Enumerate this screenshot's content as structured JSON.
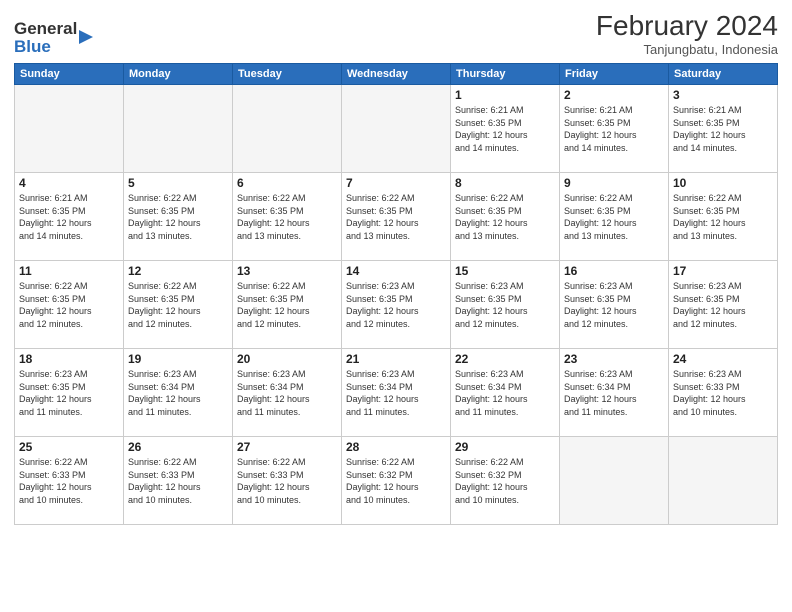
{
  "header": {
    "logo_general": "General",
    "logo_blue": "Blue",
    "month_year": "February 2024",
    "location": "Tanjungbatu, Indonesia"
  },
  "days_of_week": [
    "Sunday",
    "Monday",
    "Tuesday",
    "Wednesday",
    "Thursday",
    "Friday",
    "Saturday"
  ],
  "weeks": [
    [
      {
        "day": "",
        "info": ""
      },
      {
        "day": "",
        "info": ""
      },
      {
        "day": "",
        "info": ""
      },
      {
        "day": "",
        "info": ""
      },
      {
        "day": "1",
        "info": "Sunrise: 6:21 AM\nSunset: 6:35 PM\nDaylight: 12 hours\nand 14 minutes."
      },
      {
        "day": "2",
        "info": "Sunrise: 6:21 AM\nSunset: 6:35 PM\nDaylight: 12 hours\nand 14 minutes."
      },
      {
        "day": "3",
        "info": "Sunrise: 6:21 AM\nSunset: 6:35 PM\nDaylight: 12 hours\nand 14 minutes."
      }
    ],
    [
      {
        "day": "4",
        "info": "Sunrise: 6:21 AM\nSunset: 6:35 PM\nDaylight: 12 hours\nand 14 minutes."
      },
      {
        "day": "5",
        "info": "Sunrise: 6:22 AM\nSunset: 6:35 PM\nDaylight: 12 hours\nand 13 minutes."
      },
      {
        "day": "6",
        "info": "Sunrise: 6:22 AM\nSunset: 6:35 PM\nDaylight: 12 hours\nand 13 minutes."
      },
      {
        "day": "7",
        "info": "Sunrise: 6:22 AM\nSunset: 6:35 PM\nDaylight: 12 hours\nand 13 minutes."
      },
      {
        "day": "8",
        "info": "Sunrise: 6:22 AM\nSunset: 6:35 PM\nDaylight: 12 hours\nand 13 minutes."
      },
      {
        "day": "9",
        "info": "Sunrise: 6:22 AM\nSunset: 6:35 PM\nDaylight: 12 hours\nand 13 minutes."
      },
      {
        "day": "10",
        "info": "Sunrise: 6:22 AM\nSunset: 6:35 PM\nDaylight: 12 hours\nand 13 minutes."
      }
    ],
    [
      {
        "day": "11",
        "info": "Sunrise: 6:22 AM\nSunset: 6:35 PM\nDaylight: 12 hours\nand 12 minutes."
      },
      {
        "day": "12",
        "info": "Sunrise: 6:22 AM\nSunset: 6:35 PM\nDaylight: 12 hours\nand 12 minutes."
      },
      {
        "day": "13",
        "info": "Sunrise: 6:22 AM\nSunset: 6:35 PM\nDaylight: 12 hours\nand 12 minutes."
      },
      {
        "day": "14",
        "info": "Sunrise: 6:23 AM\nSunset: 6:35 PM\nDaylight: 12 hours\nand 12 minutes."
      },
      {
        "day": "15",
        "info": "Sunrise: 6:23 AM\nSunset: 6:35 PM\nDaylight: 12 hours\nand 12 minutes."
      },
      {
        "day": "16",
        "info": "Sunrise: 6:23 AM\nSunset: 6:35 PM\nDaylight: 12 hours\nand 12 minutes."
      },
      {
        "day": "17",
        "info": "Sunrise: 6:23 AM\nSunset: 6:35 PM\nDaylight: 12 hours\nand 12 minutes."
      }
    ],
    [
      {
        "day": "18",
        "info": "Sunrise: 6:23 AM\nSunset: 6:35 PM\nDaylight: 12 hours\nand 11 minutes."
      },
      {
        "day": "19",
        "info": "Sunrise: 6:23 AM\nSunset: 6:34 PM\nDaylight: 12 hours\nand 11 minutes."
      },
      {
        "day": "20",
        "info": "Sunrise: 6:23 AM\nSunset: 6:34 PM\nDaylight: 12 hours\nand 11 minutes."
      },
      {
        "day": "21",
        "info": "Sunrise: 6:23 AM\nSunset: 6:34 PM\nDaylight: 12 hours\nand 11 minutes."
      },
      {
        "day": "22",
        "info": "Sunrise: 6:23 AM\nSunset: 6:34 PM\nDaylight: 12 hours\nand 11 minutes."
      },
      {
        "day": "23",
        "info": "Sunrise: 6:23 AM\nSunset: 6:34 PM\nDaylight: 12 hours\nand 11 minutes."
      },
      {
        "day": "24",
        "info": "Sunrise: 6:23 AM\nSunset: 6:33 PM\nDaylight: 12 hours\nand 10 minutes."
      }
    ],
    [
      {
        "day": "25",
        "info": "Sunrise: 6:22 AM\nSunset: 6:33 PM\nDaylight: 12 hours\nand 10 minutes."
      },
      {
        "day": "26",
        "info": "Sunrise: 6:22 AM\nSunset: 6:33 PM\nDaylight: 12 hours\nand 10 minutes."
      },
      {
        "day": "27",
        "info": "Sunrise: 6:22 AM\nSunset: 6:33 PM\nDaylight: 12 hours\nand 10 minutes."
      },
      {
        "day": "28",
        "info": "Sunrise: 6:22 AM\nSunset: 6:32 PM\nDaylight: 12 hours\nand 10 minutes."
      },
      {
        "day": "29",
        "info": "Sunrise: 6:22 AM\nSunset: 6:32 PM\nDaylight: 12 hours\nand 10 minutes."
      },
      {
        "day": "",
        "info": ""
      },
      {
        "day": "",
        "info": ""
      }
    ]
  ]
}
